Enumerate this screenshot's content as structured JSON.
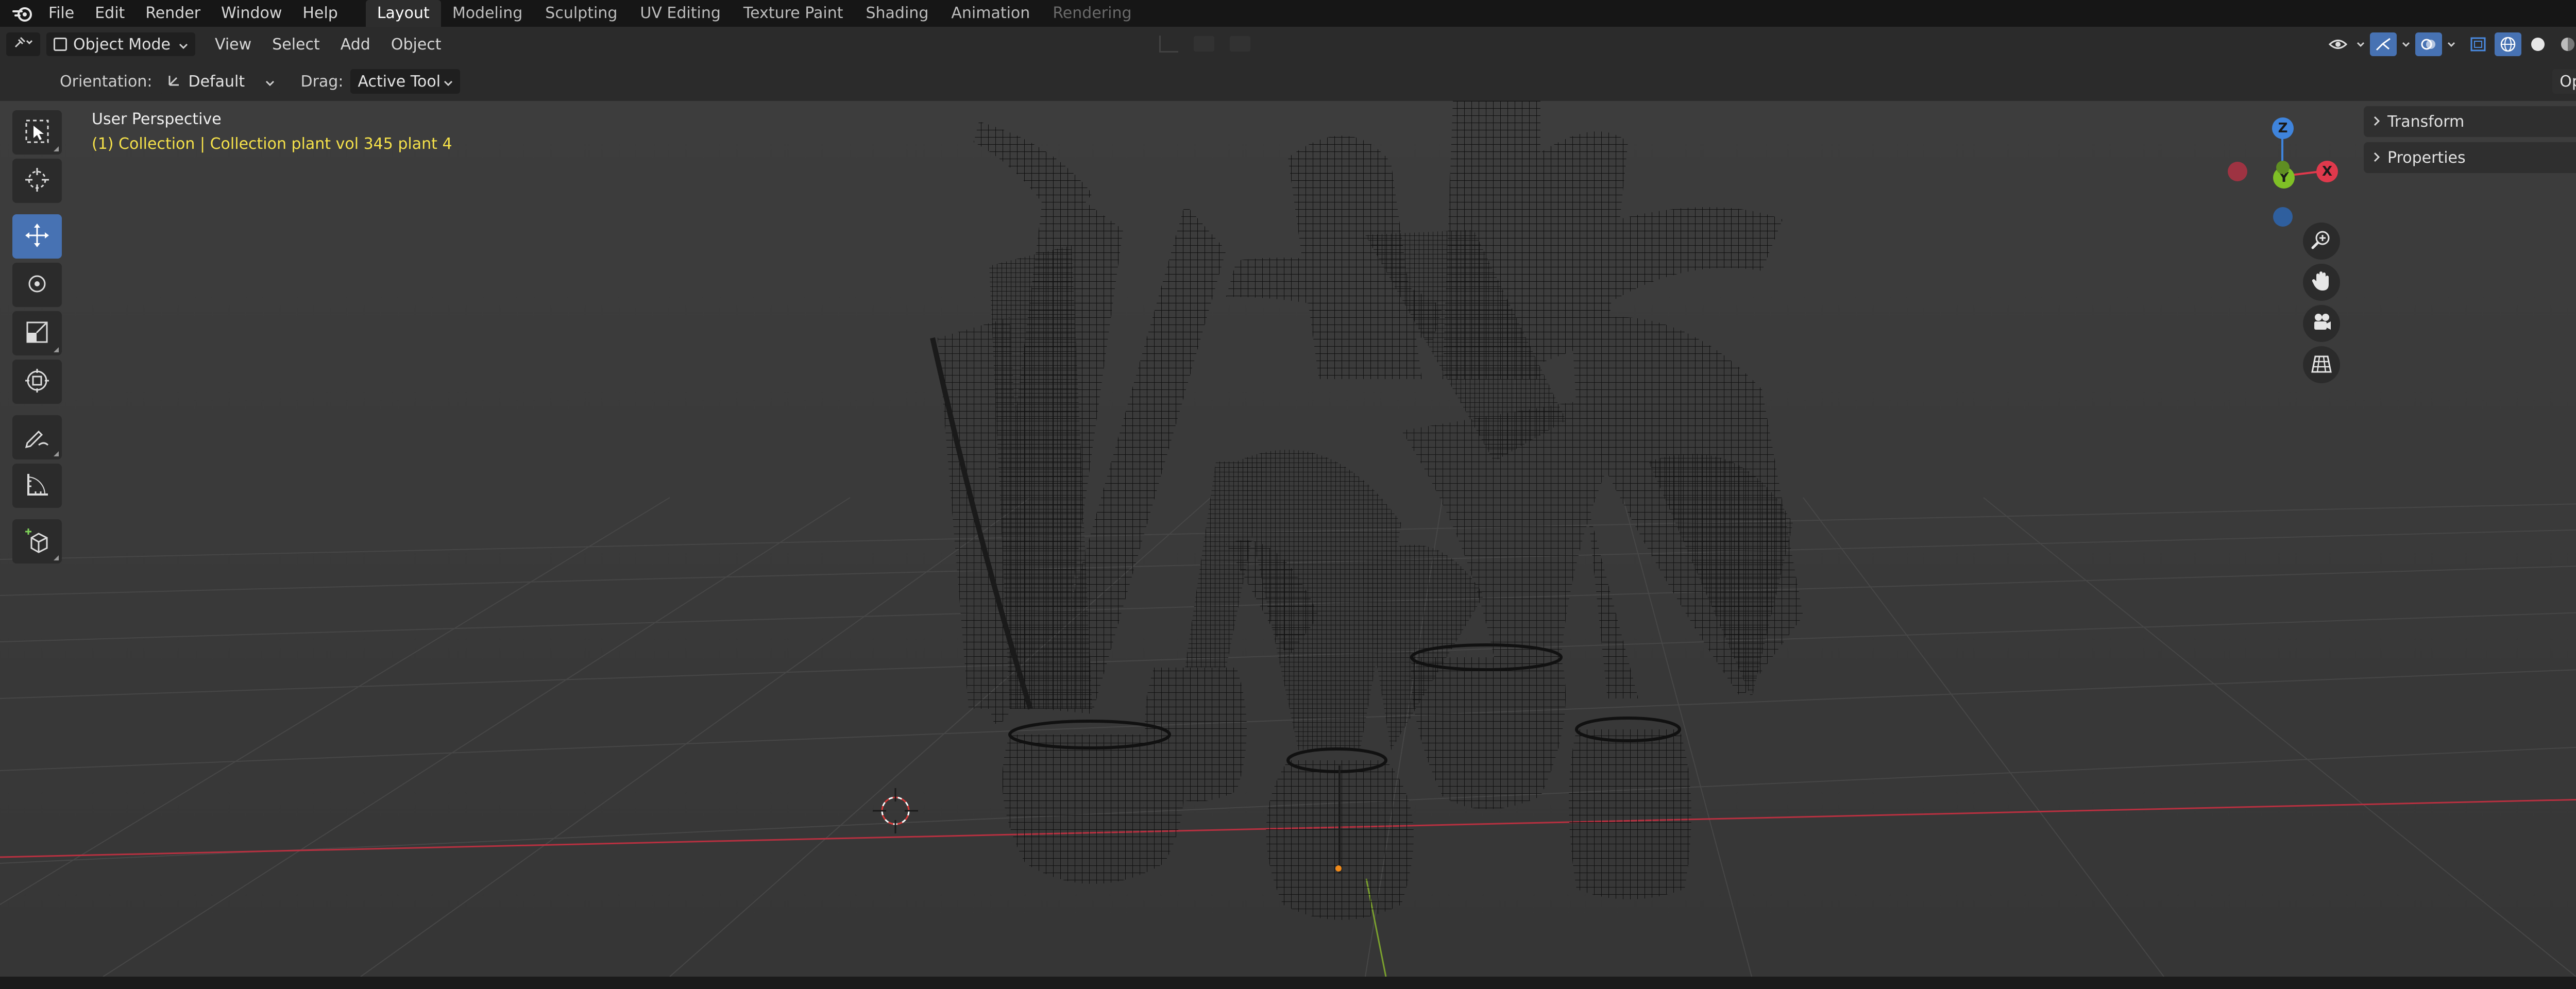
{
  "menubar": {
    "items": [
      "File",
      "Edit",
      "Render",
      "Window",
      "Help"
    ],
    "workspaces": [
      {
        "label": "Layout",
        "active": true
      },
      {
        "label": "Modeling"
      },
      {
        "label": "Sculpting"
      },
      {
        "label": "UV Editing"
      },
      {
        "label": "Texture Paint"
      },
      {
        "label": "Shading"
      },
      {
        "label": "Animation"
      },
      {
        "label": "Rendering",
        "faded": true
      }
    ]
  },
  "header": {
    "mode": "Object Mode",
    "menus": [
      "View",
      "Select",
      "Add",
      "Object"
    ]
  },
  "toolsettings": {
    "orientation_label": "Orientation:",
    "orientation_value": "Default",
    "drag_label": "Drag:",
    "drag_value": "Active Tool",
    "options_label": "Options"
  },
  "viewport": {
    "perspective": "User Perspective",
    "collection_info": "(1) Collection | Collection plant vol 345 plant 4"
  },
  "toolbar": {
    "tools": [
      "select-box",
      "cursor",
      "move",
      "rotate",
      "scale",
      "transform",
      "annotate",
      "measure",
      "add-cube"
    ],
    "active": "move"
  },
  "gizmo": {
    "axes": {
      "x": "X",
      "y": "Y",
      "z": "Z"
    },
    "colors": {
      "x": "#e0394c",
      "y": "#7fc026",
      "z": "#3f84dc"
    }
  },
  "npanel": {
    "sections": [
      "Transform",
      "Properties"
    ]
  },
  "colors": {
    "accent": "#4772b3",
    "collection_text": "#f5e14a",
    "x_axis_line": "#b83040",
    "y_axis_line": "#7aa02e"
  }
}
